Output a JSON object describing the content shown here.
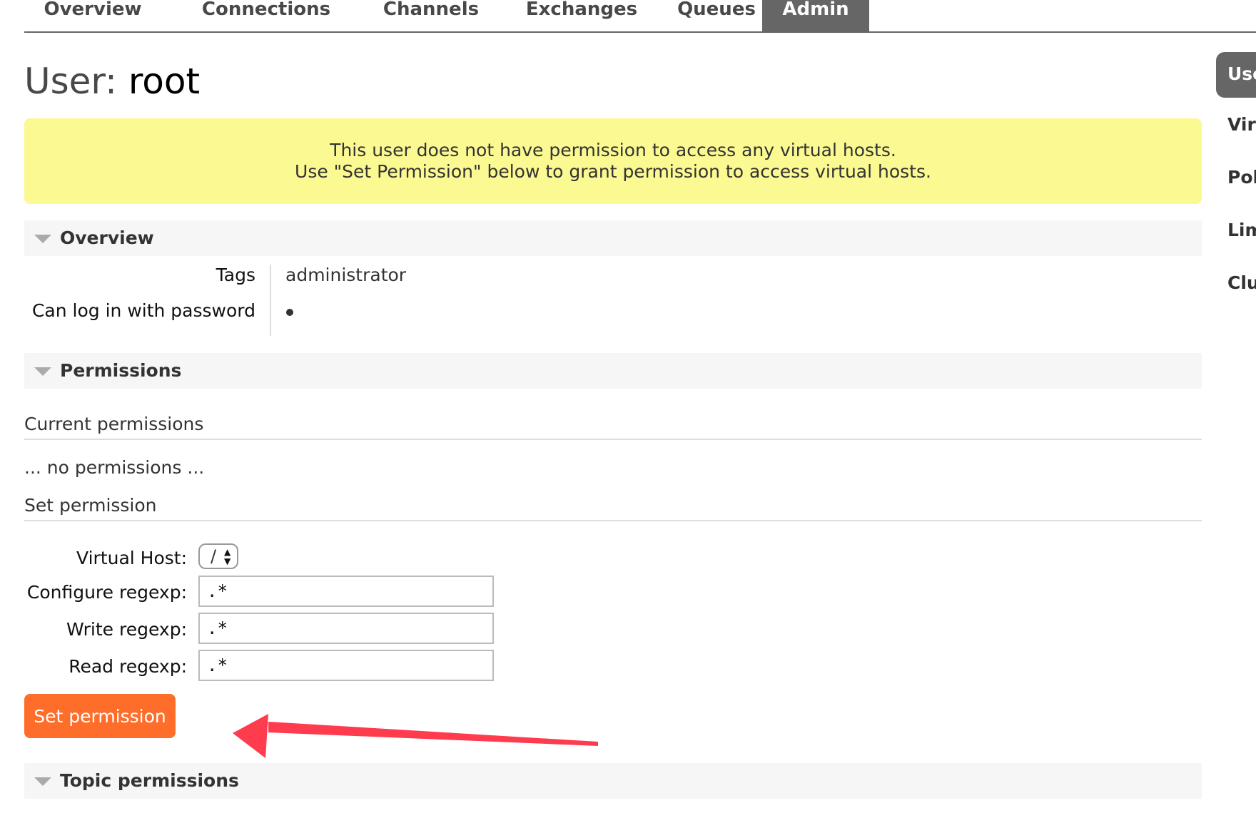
{
  "nav": {
    "tabs": [
      {
        "label": "Overview"
      },
      {
        "label": "Connections"
      },
      {
        "label": "Channels"
      },
      {
        "label": "Exchanges"
      },
      {
        "label": "Queues"
      },
      {
        "label": "Admin",
        "active": true
      }
    ]
  },
  "title": {
    "prefix": "User:",
    "name": "root"
  },
  "warning": {
    "line1": "This user does not have permission to access any virtual hosts.",
    "line2": "Use \"Set Permission\" below to grant permission to access virtual hosts."
  },
  "overview": {
    "heading": "Overview",
    "tags_label": "Tags",
    "tags_value": "administrator",
    "login_label": "Can log in with password"
  },
  "permissions": {
    "heading": "Permissions",
    "current_heading": "Current permissions",
    "empty_text": "... no permissions ...",
    "set_heading": "Set permission",
    "vhost_label": "Virtual Host:",
    "vhost_value": "/",
    "configure_label": "Configure regexp:",
    "configure_value": ".*",
    "write_label": "Write regexp:",
    "write_value": ".*",
    "read_label": "Read regexp:",
    "read_value": ".*",
    "submit_label": "Set permission"
  },
  "topic": {
    "heading": "Topic permissions"
  },
  "sidebar": {
    "items": [
      {
        "label": "Users",
        "active": true
      },
      {
        "label": "Virtual Hosts"
      },
      {
        "label": "Policies"
      },
      {
        "label": "Limits"
      },
      {
        "label": "Cluster"
      }
    ]
  },
  "colors": {
    "accent": "#ff6d2a",
    "warning_bg": "#fbf991",
    "nav_active": "#666666",
    "annotation_arrow": "#ff3b4e"
  }
}
